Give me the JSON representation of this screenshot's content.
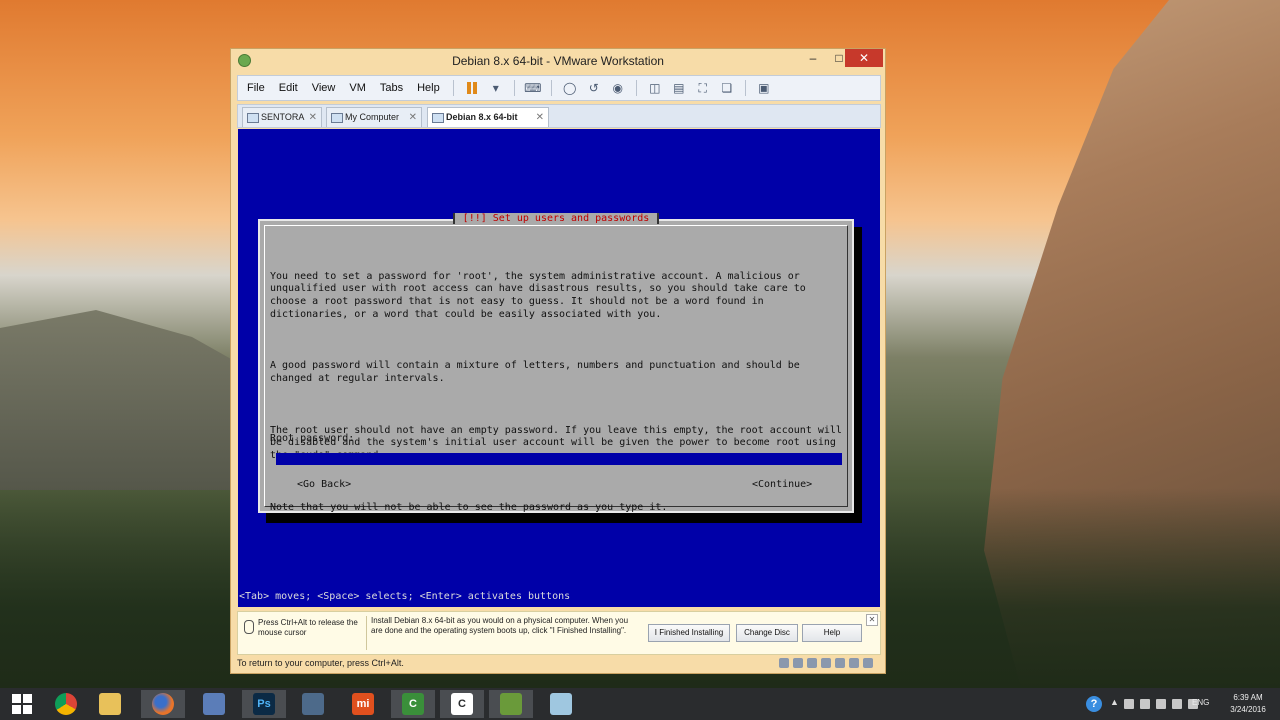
{
  "window": {
    "title": "Debian 8.x 64-bit - VMware Workstation",
    "minimize": "–",
    "maximize": "□",
    "close": "✕"
  },
  "menu": [
    "File",
    "Edit",
    "View",
    "VM",
    "Tabs",
    "Help"
  ],
  "toolbar_icons": [
    "power-pause-icon",
    "dropdown-icon",
    "send-ctrl-alt-del-icon",
    "snapshot-icon",
    "revert-snapshot-icon",
    "snapshot-manager-icon",
    "library-icon",
    "thumbnail-icon",
    "fullscreen-icon",
    "unity-icon",
    "console-view-icon"
  ],
  "tabs": [
    {
      "label": "SENTORA",
      "active": false
    },
    {
      "label": "My Computer",
      "active": false
    },
    {
      "label": "Debian 8.x 64-bit",
      "active": true
    }
  ],
  "tab_close": "✕",
  "installer": {
    "title": "[!!] Set up users and passwords",
    "paragraphs": [
      "You need to set a password for 'root', the system administrative account. A malicious or unqualified user with root access can have disastrous results, so you should take care to choose a root password that is not easy to guess. It should not be a word found in dictionaries, or a word that could be easily associated with you.",
      "A good password will contain a mixture of letters, numbers and punctuation and should be changed at regular intervals.",
      "The root user should not have an empty password. If you leave this empty, the root account will be disabled and the system's initial user account will be given the power to become root using the \"sudo\" command.",
      "Note that you will not be able to see the password as you type it."
    ],
    "password_label": "Root password:",
    "password_value": "",
    "back_button": "<Go Back>",
    "continue_button": "<Continue>",
    "hint": "<Tab> moves; <Space> selects; <Enter> activates buttons"
  },
  "install_bar": {
    "mouse_hint": "Press Ctrl+Alt to release the mouse cursor",
    "message": "Install Debian 8.x 64-bit as you would on a physical computer. When you are done and the operating system boots up, click \"I Finished Installing\".",
    "finished_button": "I Finished Installing",
    "change_disc_button": "Change Disc",
    "help_button": "Help",
    "close": "✕"
  },
  "status": "To return to your computer, press Ctrl+Alt.",
  "taskbar": {
    "apps": [
      "start-icon",
      "chrome-icon",
      "file-explorer-icon",
      "firefox-icon",
      "network-tool-icon",
      "photoshop-icon",
      "windows-media-icon",
      "mi-icon",
      "camtasia-icon",
      "camtasia-recorder-icon",
      "vmware-icon",
      "notepad-icon"
    ],
    "photoshop_label": "Ps",
    "mi_label": "mi",
    "camtasia_label": "C",
    "help_label": "?",
    "tray_arrow": "▲",
    "language": "ENG",
    "time": "6:39 AM",
    "date": "3/24/2016"
  }
}
